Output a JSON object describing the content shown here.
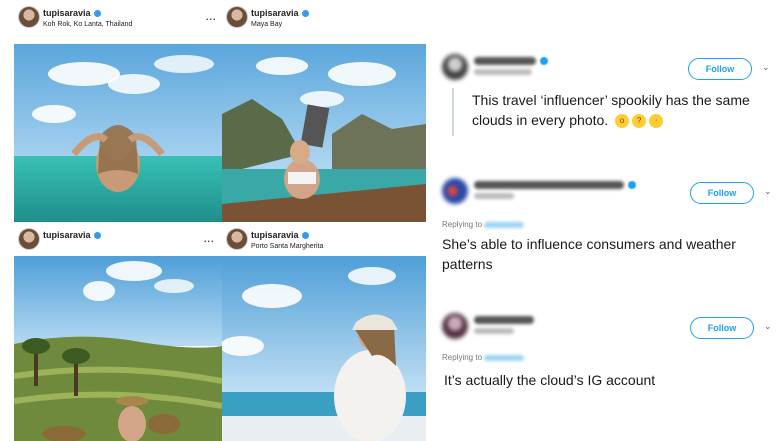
{
  "colors": {
    "follow": "#1da1f2",
    "ig_verified": "#3897f0",
    "emoji": "#ffcc33"
  },
  "instagram_posts": [
    {
      "username": "tupisaravia",
      "location": "Koh Rok, Ko Lanta, Thailand",
      "menu": "..."
    },
    {
      "username": "tupisaravia",
      "location": "Maya Bay",
      "menu": "..."
    },
    {
      "username": "tupisaravia",
      "location": "",
      "menu": "..."
    },
    {
      "username": "tupisaravia",
      "location": "Porto Santa Margherita",
      "menu": ""
    }
  ],
  "tweets": [
    {
      "text": "This travel ‘influencer’ spookily has the same clouds in every photo.",
      "follow_label": "Follow",
      "replying": "",
      "emoji": [
        "smiley-shocked-icon",
        "thinking-face-icon",
        "laughing-face-icon"
      ]
    },
    {
      "text": "She’s able to influence consumers and weather patterns",
      "follow_label": "Follow",
      "replying": "Replying to"
    },
    {
      "text": "It’s actually the cloud’s IG account",
      "follow_label": "Follow",
      "replying": "Replying to"
    }
  ]
}
